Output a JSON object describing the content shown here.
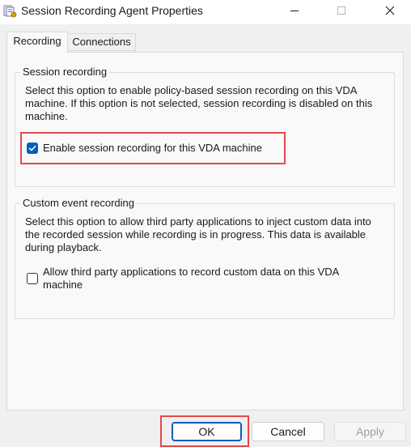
{
  "window": {
    "title": "Session Recording Agent Properties",
    "icon": "properties-sheet-icon",
    "controls": [
      "minimize-icon",
      "maximize-icon",
      "close-icon"
    ]
  },
  "tabs": [
    {
      "label": "Recording",
      "selected": true
    },
    {
      "label": "Connections",
      "selected": false
    }
  ],
  "session_recording": {
    "legend": "Session recording",
    "description": "Select this option to enable policy-based session recording on this VDA machine. If this option is not selected, session recording is disabled on this machine.",
    "checkbox_label": "Enable session recording for this VDA machine",
    "checked": true
  },
  "custom_event_recording": {
    "legend": "Custom event recording",
    "description": "Select this option to allow third party applications to inject custom data into the recorded session while recording is in progress. This data is available during playback.",
    "checkbox_label": "Allow third party applications to record custom data on this VDA machine",
    "checked": false
  },
  "buttons": {
    "ok": "OK",
    "cancel": "Cancel",
    "apply": "Apply"
  },
  "colors": {
    "accent": "#005fb8",
    "highlight": "#e4474f",
    "dialog_bg": "#f0f0f0",
    "panel_bg": "#f9f9f9"
  }
}
